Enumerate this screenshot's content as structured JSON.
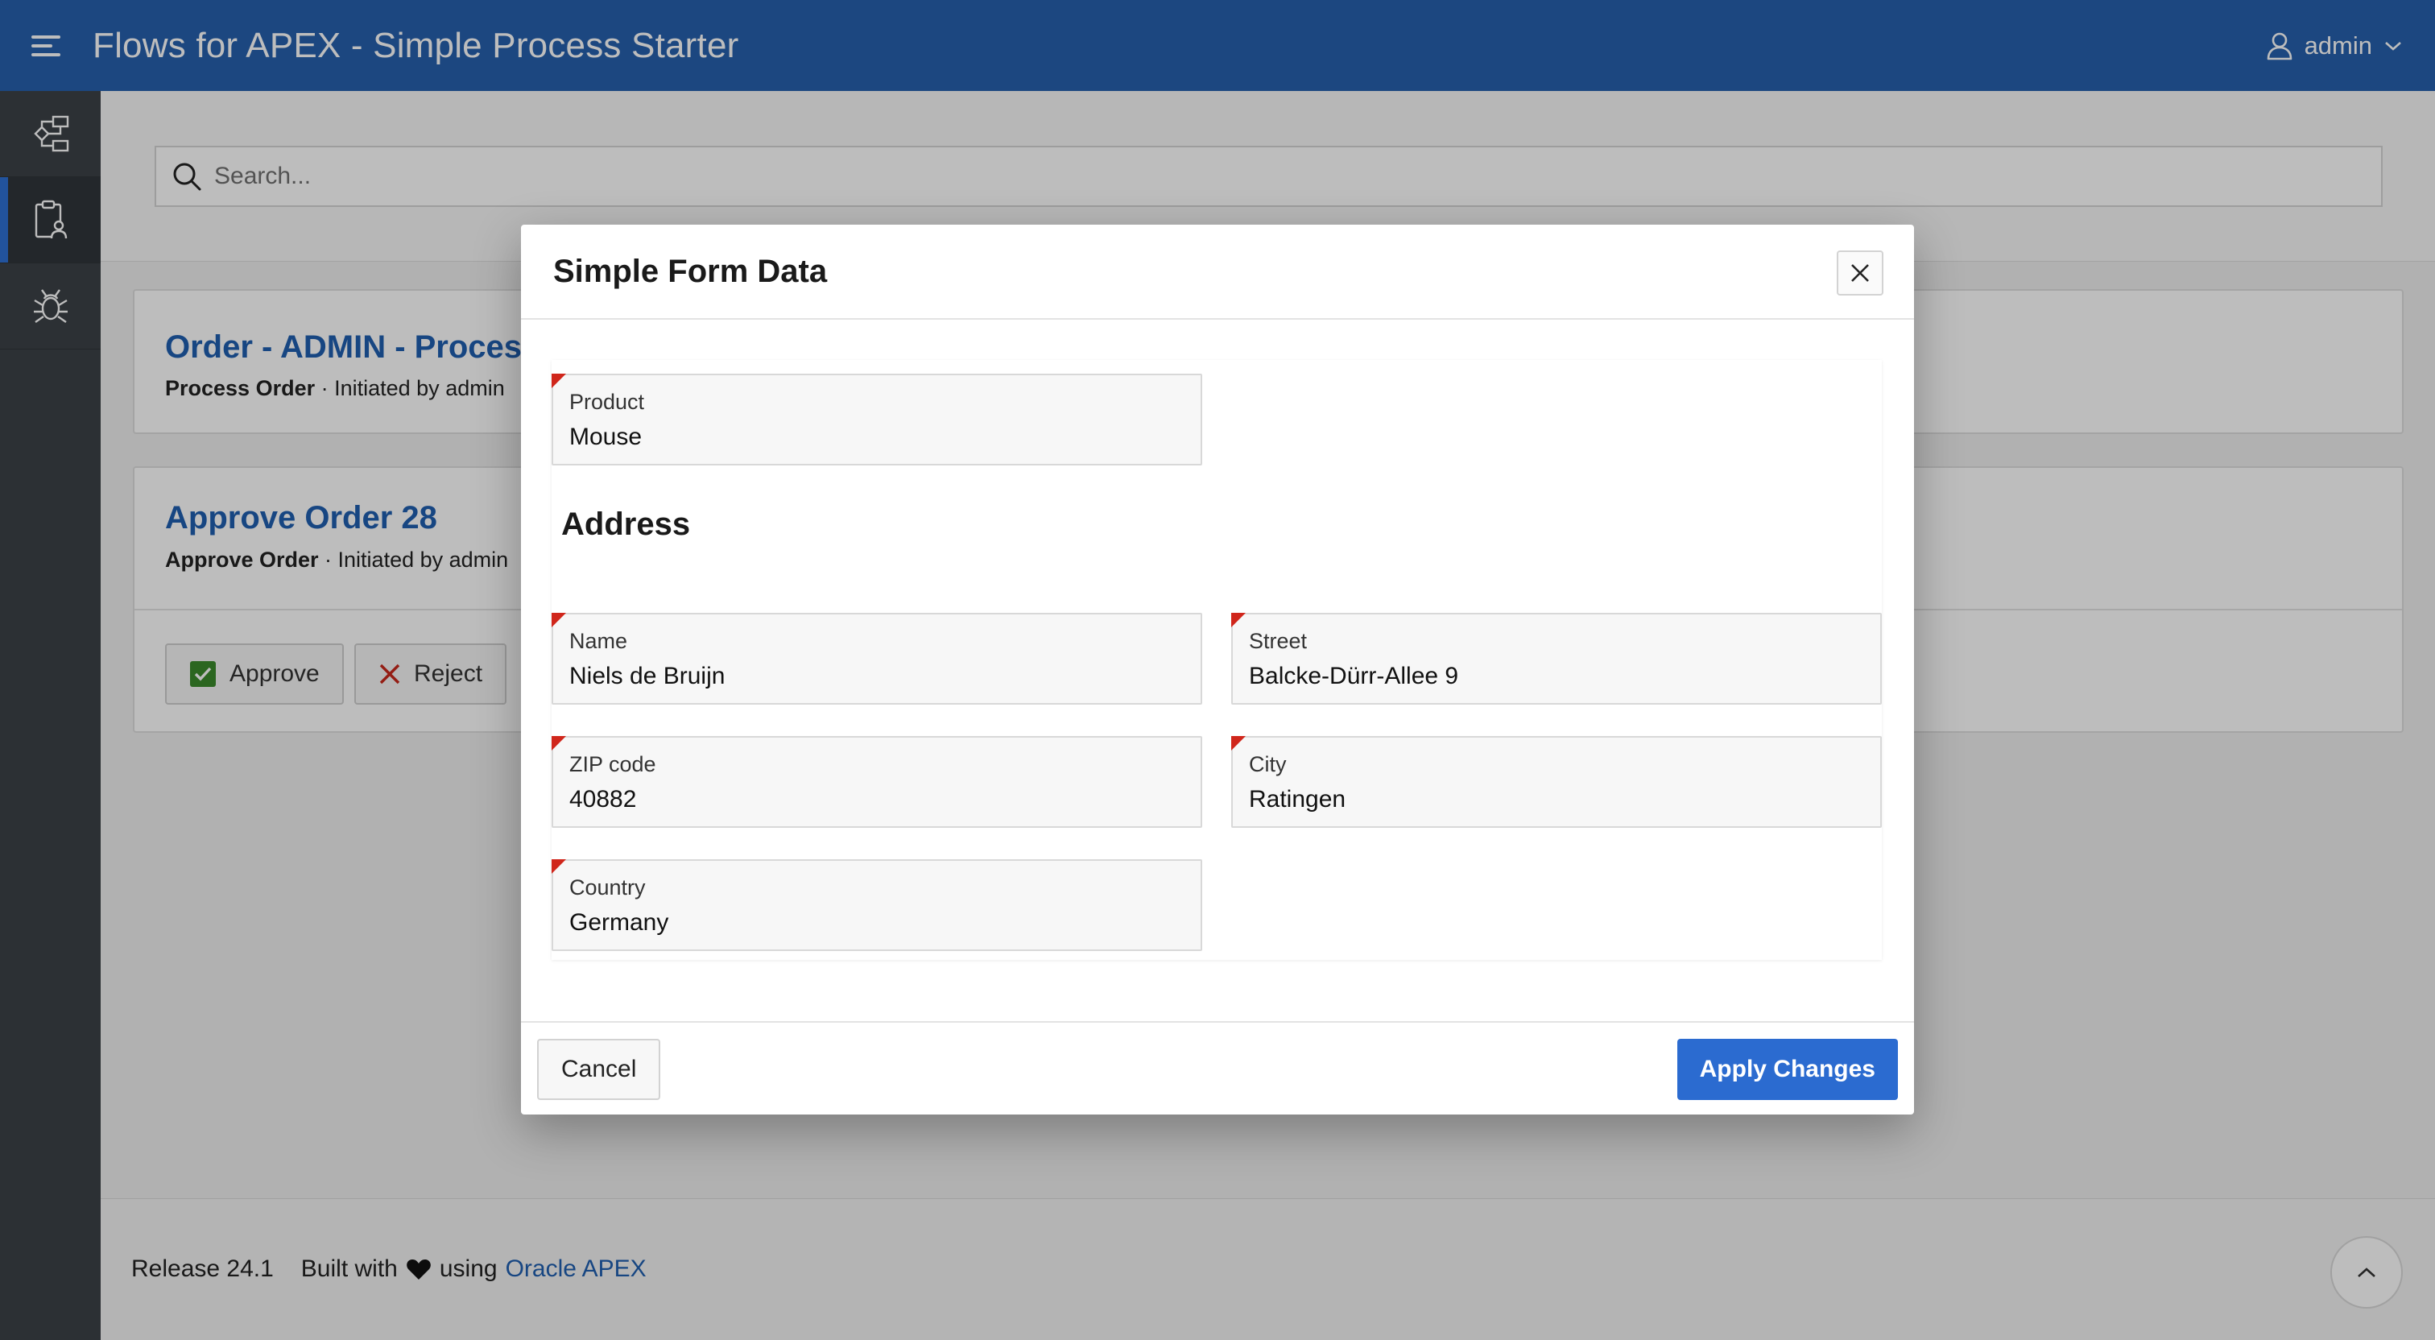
{
  "app": {
    "title": "Flows for APEX - Simple Process Starter",
    "user": "admin"
  },
  "sidebar": {
    "items": [
      {
        "icon": "process-diagram-icon",
        "active": false
      },
      {
        "icon": "clipboard-user-icon",
        "active": true
      },
      {
        "icon": "bug-icon",
        "active": false
      }
    ]
  },
  "search": {
    "placeholder": "Search..."
  },
  "tasks": [
    {
      "title": "Order - ADMIN - Process Order",
      "task_type": "Process Order",
      "initiated": " · Initiated by admin"
    },
    {
      "title": "Approve Order 28",
      "task_type": "Approve Order",
      "initiated": " · Initiated by admin",
      "actions": {
        "approve": "Approve",
        "reject": "Reject"
      }
    }
  ],
  "footer": {
    "release": "Release 24.1",
    "built_with": "Built with",
    "using": "using",
    "link": "Oracle APEX"
  },
  "dialog": {
    "title": "Simple Form Data",
    "section_title": "Address",
    "fields": {
      "product": {
        "label": "Product",
        "value": "Mouse"
      },
      "name": {
        "label": "Name",
        "value": "Niels de Bruijn"
      },
      "street": {
        "label": "Street",
        "value": "Balcke-Dürr-Allee 9"
      },
      "zip": {
        "label": "ZIP code",
        "value": "40882"
      },
      "city": {
        "label": "City",
        "value": "Ratingen"
      },
      "country": {
        "label": "Country",
        "value": "Germany"
      }
    },
    "cancel_label": "Cancel",
    "apply_label": "Apply Changes"
  },
  "colors": {
    "header": "#2660ad",
    "primary_button": "#2b6bd0",
    "required_marker": "#d0261b",
    "approve_check": "#3b8a2c",
    "reject_x": "#c8281b"
  }
}
